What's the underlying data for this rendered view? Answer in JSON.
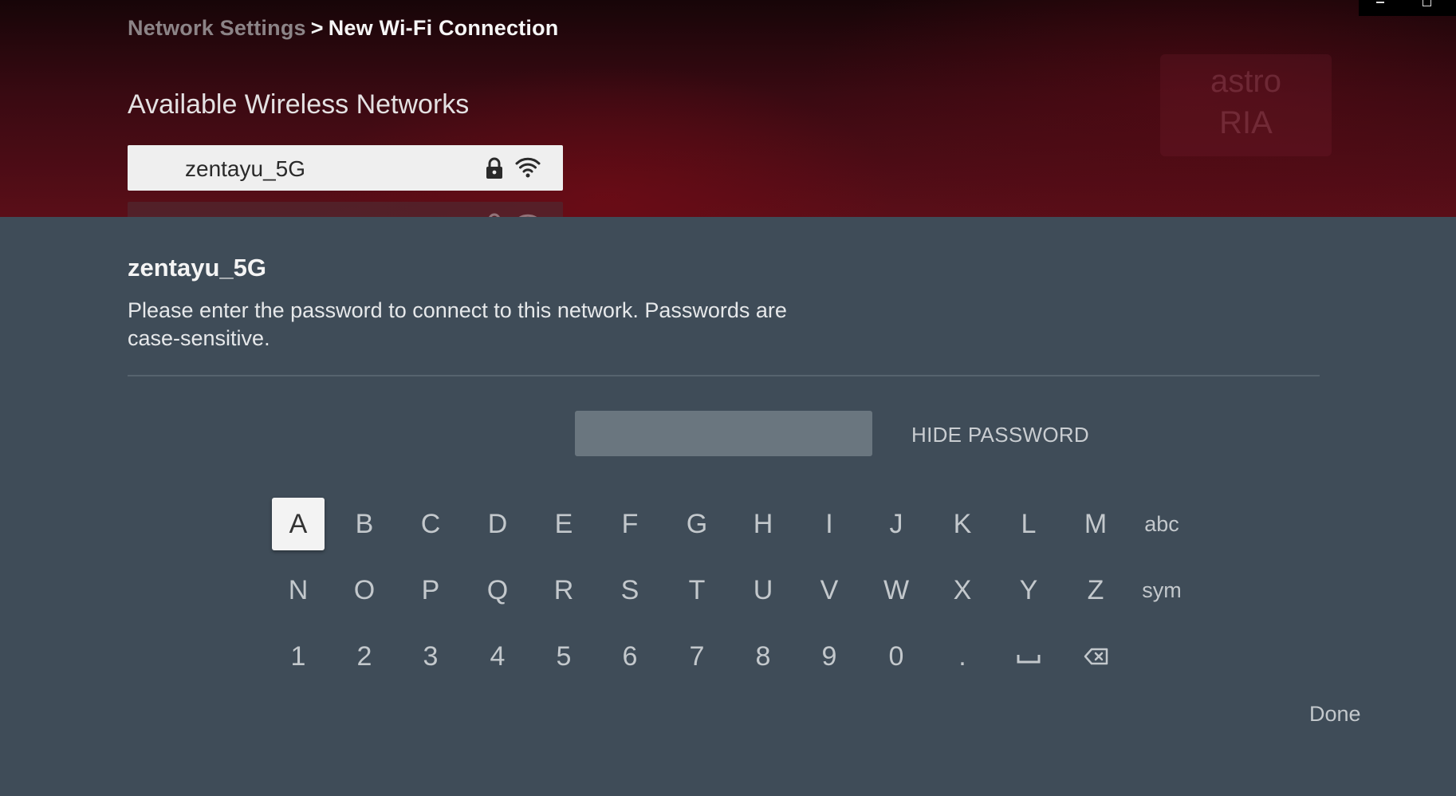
{
  "breadcrumb": {
    "parent": "Network Settings",
    "separator": ">",
    "current": "New Wi-Fi Connection"
  },
  "networks": {
    "section_title": "Available Wireless Networks",
    "items": [
      {
        "name": "zentayu_5G",
        "secured": true,
        "signal_icon": "wifi-full-icon",
        "focused": true
      }
    ]
  },
  "watermark": {
    "line1": "astro",
    "line2": "RIA"
  },
  "dialog": {
    "network_name": "zentayu_5G",
    "message": "Please enter the password to connect to this network. Passwords are case-sensitive.",
    "password_value": "",
    "hide_password_label": "HIDE PASSWORD",
    "done_label": "Done"
  },
  "keyboard": {
    "rows": [
      [
        "A",
        "B",
        "C",
        "D",
        "E",
        "F",
        "G",
        "H",
        "I",
        "J",
        "K",
        "L",
        "M",
        "abc"
      ],
      [
        "N",
        "O",
        "P",
        "Q",
        "R",
        "S",
        "T",
        "U",
        "V",
        "W",
        "X",
        "Y",
        "Z",
        "sym"
      ],
      [
        "1",
        "2",
        "3",
        "4",
        "5",
        "6",
        "7",
        "8",
        "9",
        "0",
        "."
      ]
    ],
    "special_keys": {
      "space": "space-icon",
      "backspace": "backspace-icon"
    },
    "focused_key": "A"
  },
  "colors": {
    "panel_bg": "#3f4c58",
    "focused_bg": "#f3f3f3",
    "key_text": "#c3c8cc",
    "header_bg_top": "#170508",
    "header_bg_bottom": "#5a0e18"
  }
}
